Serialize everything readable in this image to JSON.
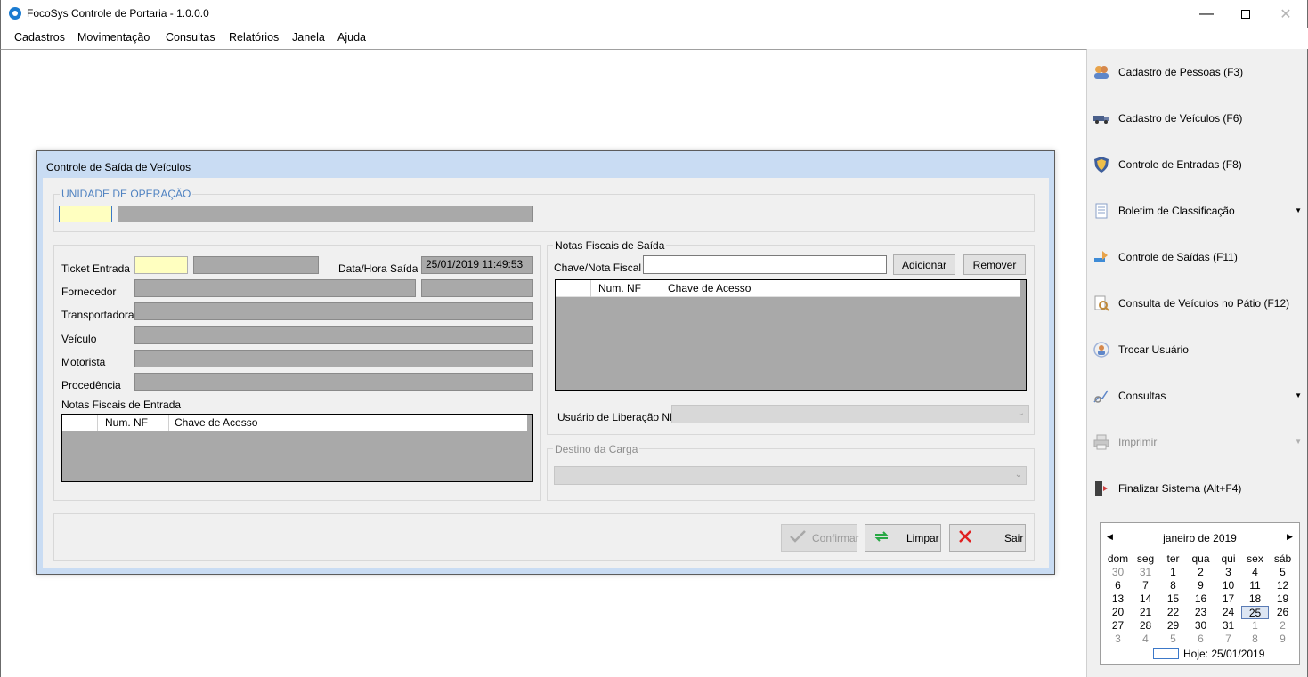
{
  "window": {
    "title": "FocoSys Controle de Portaria - 1.0.0.0"
  },
  "menu": [
    "Cadastros",
    "Movimentação",
    "Consultas",
    "Relatórios",
    "Janela",
    "Ajuda"
  ],
  "sidebar": {
    "items": [
      {
        "label": "Cadastro de Pessoas (F3)",
        "icon": "people-icon"
      },
      {
        "label": "Cadastro de Veículos (F6)",
        "icon": "truck-icon"
      },
      {
        "label": "Controle de Entradas (F8)",
        "icon": "shield-icon"
      },
      {
        "label": "Boletim de Classificação",
        "icon": "document-icon"
      },
      {
        "label": "Controle de Saídas (F11)",
        "icon": "exit-icon"
      },
      {
        "label": "Consulta de Veículos no Pátio (F12)",
        "icon": "search-document-icon"
      },
      {
        "label": "Trocar Usuário",
        "icon": "user-switch-icon"
      },
      {
        "label": "Consultas",
        "icon": "chart-search-icon"
      },
      {
        "label": "Imprimir",
        "icon": "printer-icon"
      },
      {
        "label": "Finalizar Sistema (Alt+F4)",
        "icon": "door-exit-icon"
      }
    ]
  },
  "calendar": {
    "month_label": "janeiro de 2019",
    "weekdays": [
      "dom",
      "seg",
      "ter",
      "qua",
      "qui",
      "sex",
      "sáb"
    ],
    "weeks": [
      [
        "30",
        "31",
        "1",
        "2",
        "3",
        "4",
        "5"
      ],
      [
        "6",
        "7",
        "8",
        "9",
        "10",
        "11",
        "12"
      ],
      [
        "13",
        "14",
        "15",
        "16",
        "17",
        "18",
        "19"
      ],
      [
        "20",
        "21",
        "22",
        "23",
        "24",
        "25",
        "26"
      ],
      [
        "27",
        "28",
        "29",
        "30",
        "31",
        "1",
        "2"
      ],
      [
        "3",
        "4",
        "5",
        "6",
        "7",
        "8",
        "9"
      ]
    ],
    "selected_day": "25",
    "today_label": "Hoje: 25/01/2019"
  },
  "dialog": {
    "title": "Controle de Saída de Veículos",
    "unidade_legend": "UNIDADE DE OPERAÇÃO",
    "fields": {
      "ticket_label": "Ticket Entrada",
      "datahora_label": "Data/Hora Saída",
      "datahora_value": "25/01/2019 11:49:53",
      "fornecedor_label": "Fornecedor",
      "transportadora_label": "Transportadora",
      "veiculo_label": "Veículo",
      "motorista_label": "Motorista",
      "procedencia_label": "Procedência",
      "nf_entrada_label": "Notas Fiscais de Entrada"
    },
    "nf_entrada_grid": {
      "columns": [
        "",
        "Num. NF",
        "Chave de Acesso"
      ]
    },
    "nf_saida": {
      "legend": "Notas Fiscais de Saída",
      "chave_label": "Chave/Nota Fiscal",
      "add_button": "Adicionar",
      "remove_button": "Remover",
      "columns": [
        "",
        "Num. NF",
        "Chave de Acesso"
      ],
      "usuario_label": "Usuário de Liberação NF"
    },
    "destino_legend": "Destino da Carga",
    "buttons": {
      "confirm": "Confirmar",
      "clear": "Limpar",
      "exit": "Sair"
    }
  }
}
